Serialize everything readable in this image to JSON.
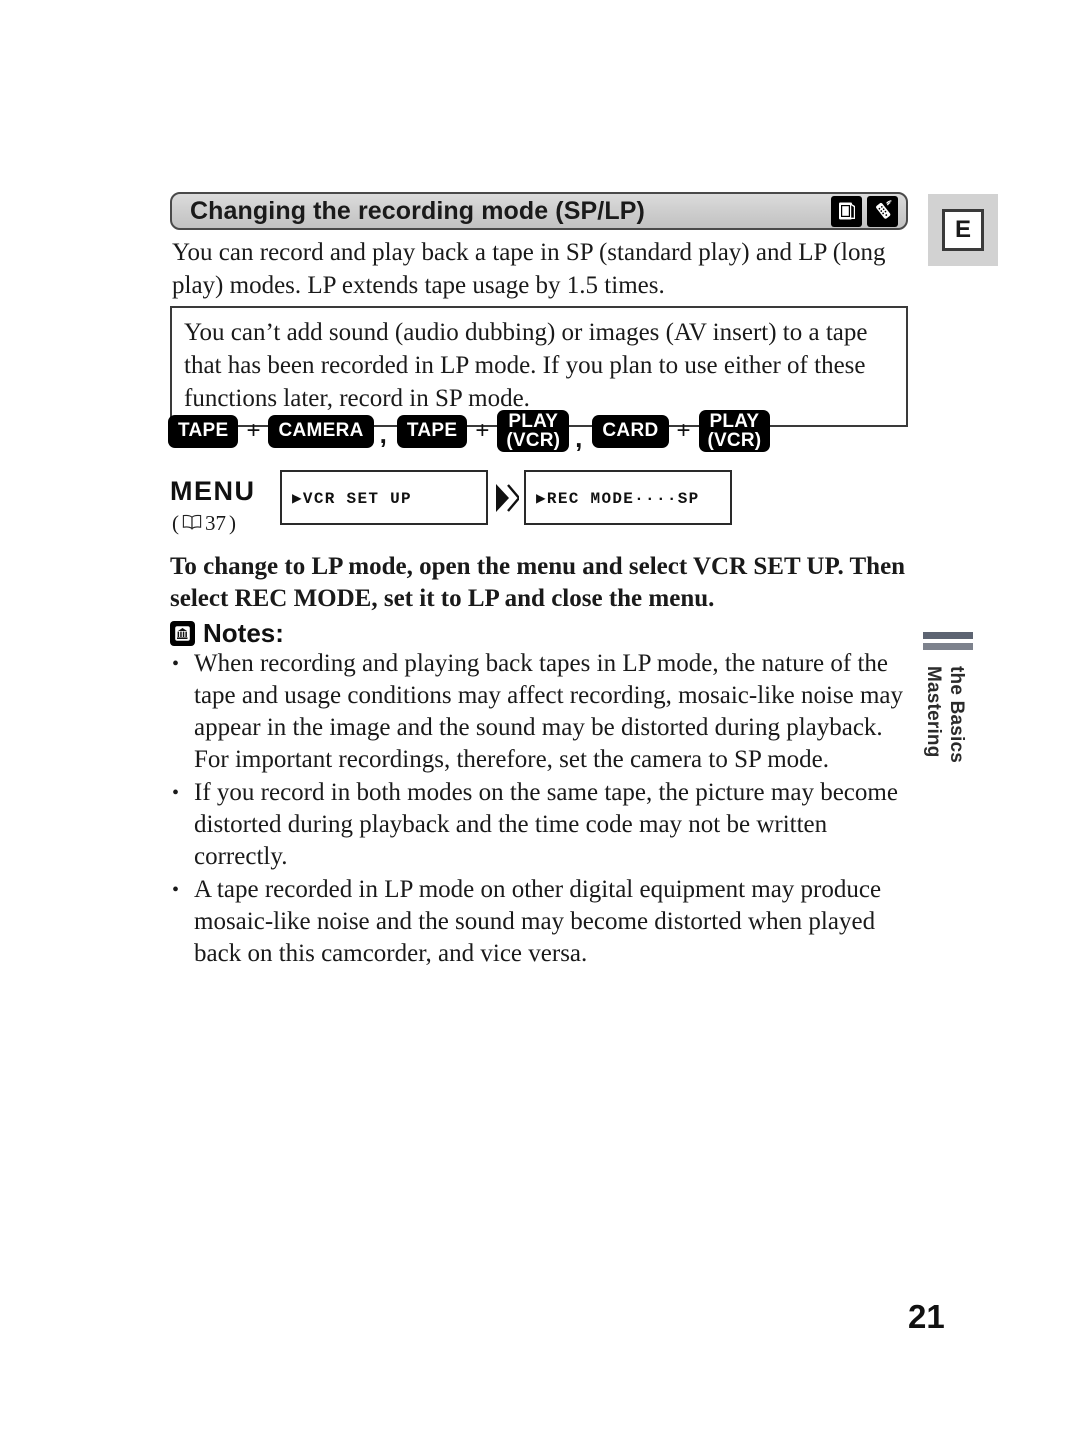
{
  "document": {
    "language_tab": "E",
    "page_number": "21",
    "side_tab": {
      "line1": "Mastering",
      "line2": "the Basics"
    }
  },
  "header": {
    "title": "Changing the recording mode (SP/LP)",
    "icons": [
      {
        "name": "memory-card-photo-icon",
        "label": "card-photo"
      },
      {
        "name": "remote-control-icon",
        "label": "remote"
      }
    ]
  },
  "intro": {
    "paragraph": "You can record and play back a tape in SP (standard play) and LP (long play) modes. LP extends tape usage by 1.5 times."
  },
  "notice": {
    "paragraph": "You can’t add sound (audio dubbing) or images (AV insert) to a tape that has been recorded in LP mode. If you plan to use either of these functions later, record in SP mode."
  },
  "mode_row": {
    "groups": [
      {
        "first": {
          "line1": "TAPE",
          "line2": ""
        },
        "operator": "+",
        "second": {
          "line1": "CAMERA",
          "line2": ""
        },
        "separator": ","
      },
      {
        "first": {
          "line1": "TAPE",
          "line2": ""
        },
        "operator": "+",
        "second": {
          "line1": "PLAY",
          "line2": "(VCR)"
        },
        "separator": ","
      },
      {
        "first": {
          "line1": "CARD",
          "line2": ""
        },
        "operator": "+",
        "second": {
          "line1": "PLAY",
          "line2": "(VCR)"
        },
        "separator": ""
      }
    ]
  },
  "menu_row": {
    "label": "MENU",
    "reference_open_paren": "(",
    "reference_page": "37",
    "reference_close_paren": ")",
    "screens": [
      {
        "text": "▶VCR SET UP"
      },
      {
        "text": "▶REC MODE····SP"
      }
    ]
  },
  "instruction": {
    "text": "To change to LP mode, open the menu and select VCR SET UP. Then select REC MODE, set it to LP and close the menu."
  },
  "notes": {
    "title": "Notes:",
    "icon": "notes-document-icon",
    "items": [
      "When recording and playing back tapes in LP mode, the nature of the tape and usage conditions may affect recording, mosaic-like noise may appear in the image and the sound may be distorted during playback. For important recordings, therefore, set the camera to SP mode.",
      "If you record in both modes on the same tape, the picture may become distorted during playback and the time code may not be written correctly.",
      "A tape recorded in LP mode on other digital equipment may produce mosaic-like noise and the sound may become distorted when played back on this camcorder, and vice versa."
    ],
    "bullet": "•"
  },
  "colors": {
    "header_bg": "#cfcfcf",
    "badge_bg": "#000000",
    "side_bar_dark": "#5d6472",
    "side_bar_light": "#7d828d",
    "tab_bg": "#d2d2d2"
  }
}
